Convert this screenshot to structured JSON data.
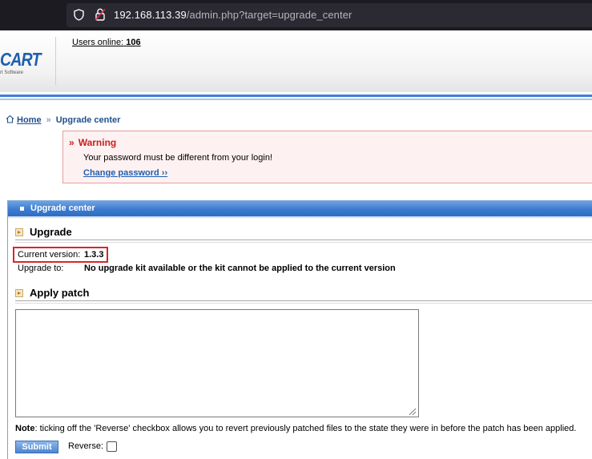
{
  "browser": {
    "url_host": "192.168.113.39",
    "url_path": "/admin.php?target=upgrade_center"
  },
  "header": {
    "logo_text": "CART",
    "logo_sub": "rt Software",
    "users_online_label": "Users online:",
    "users_online_count": "106"
  },
  "breadcrumb": {
    "home": "Home",
    "current": "Upgrade center"
  },
  "warning": {
    "title": "Warning",
    "message": "Your password must be different from your login!",
    "link": "Change password ››"
  },
  "panel": {
    "title": "Upgrade center",
    "upgrade_section": "Upgrade",
    "current_version_label": "Current version:",
    "current_version_value": "1.3.3",
    "upgrade_to_label": "Upgrade to:",
    "upgrade_to_value": "No upgrade kit available or the kit cannot be applied to the current version",
    "patch_section": "Apply patch",
    "patch_text": "",
    "note_label": "Note",
    "note_text": ": ticking off the 'Reverse' checkbox allows you to revert previously patched files to the state they were in before the patch has been applied.",
    "submit_label": "Submit",
    "reverse_label": "Reverse:",
    "reverse_checked": false
  },
  "colors": {
    "accent_blue": "#3b7bd1",
    "warning_red": "#c8201e",
    "highlight_red": "#d8262a"
  }
}
